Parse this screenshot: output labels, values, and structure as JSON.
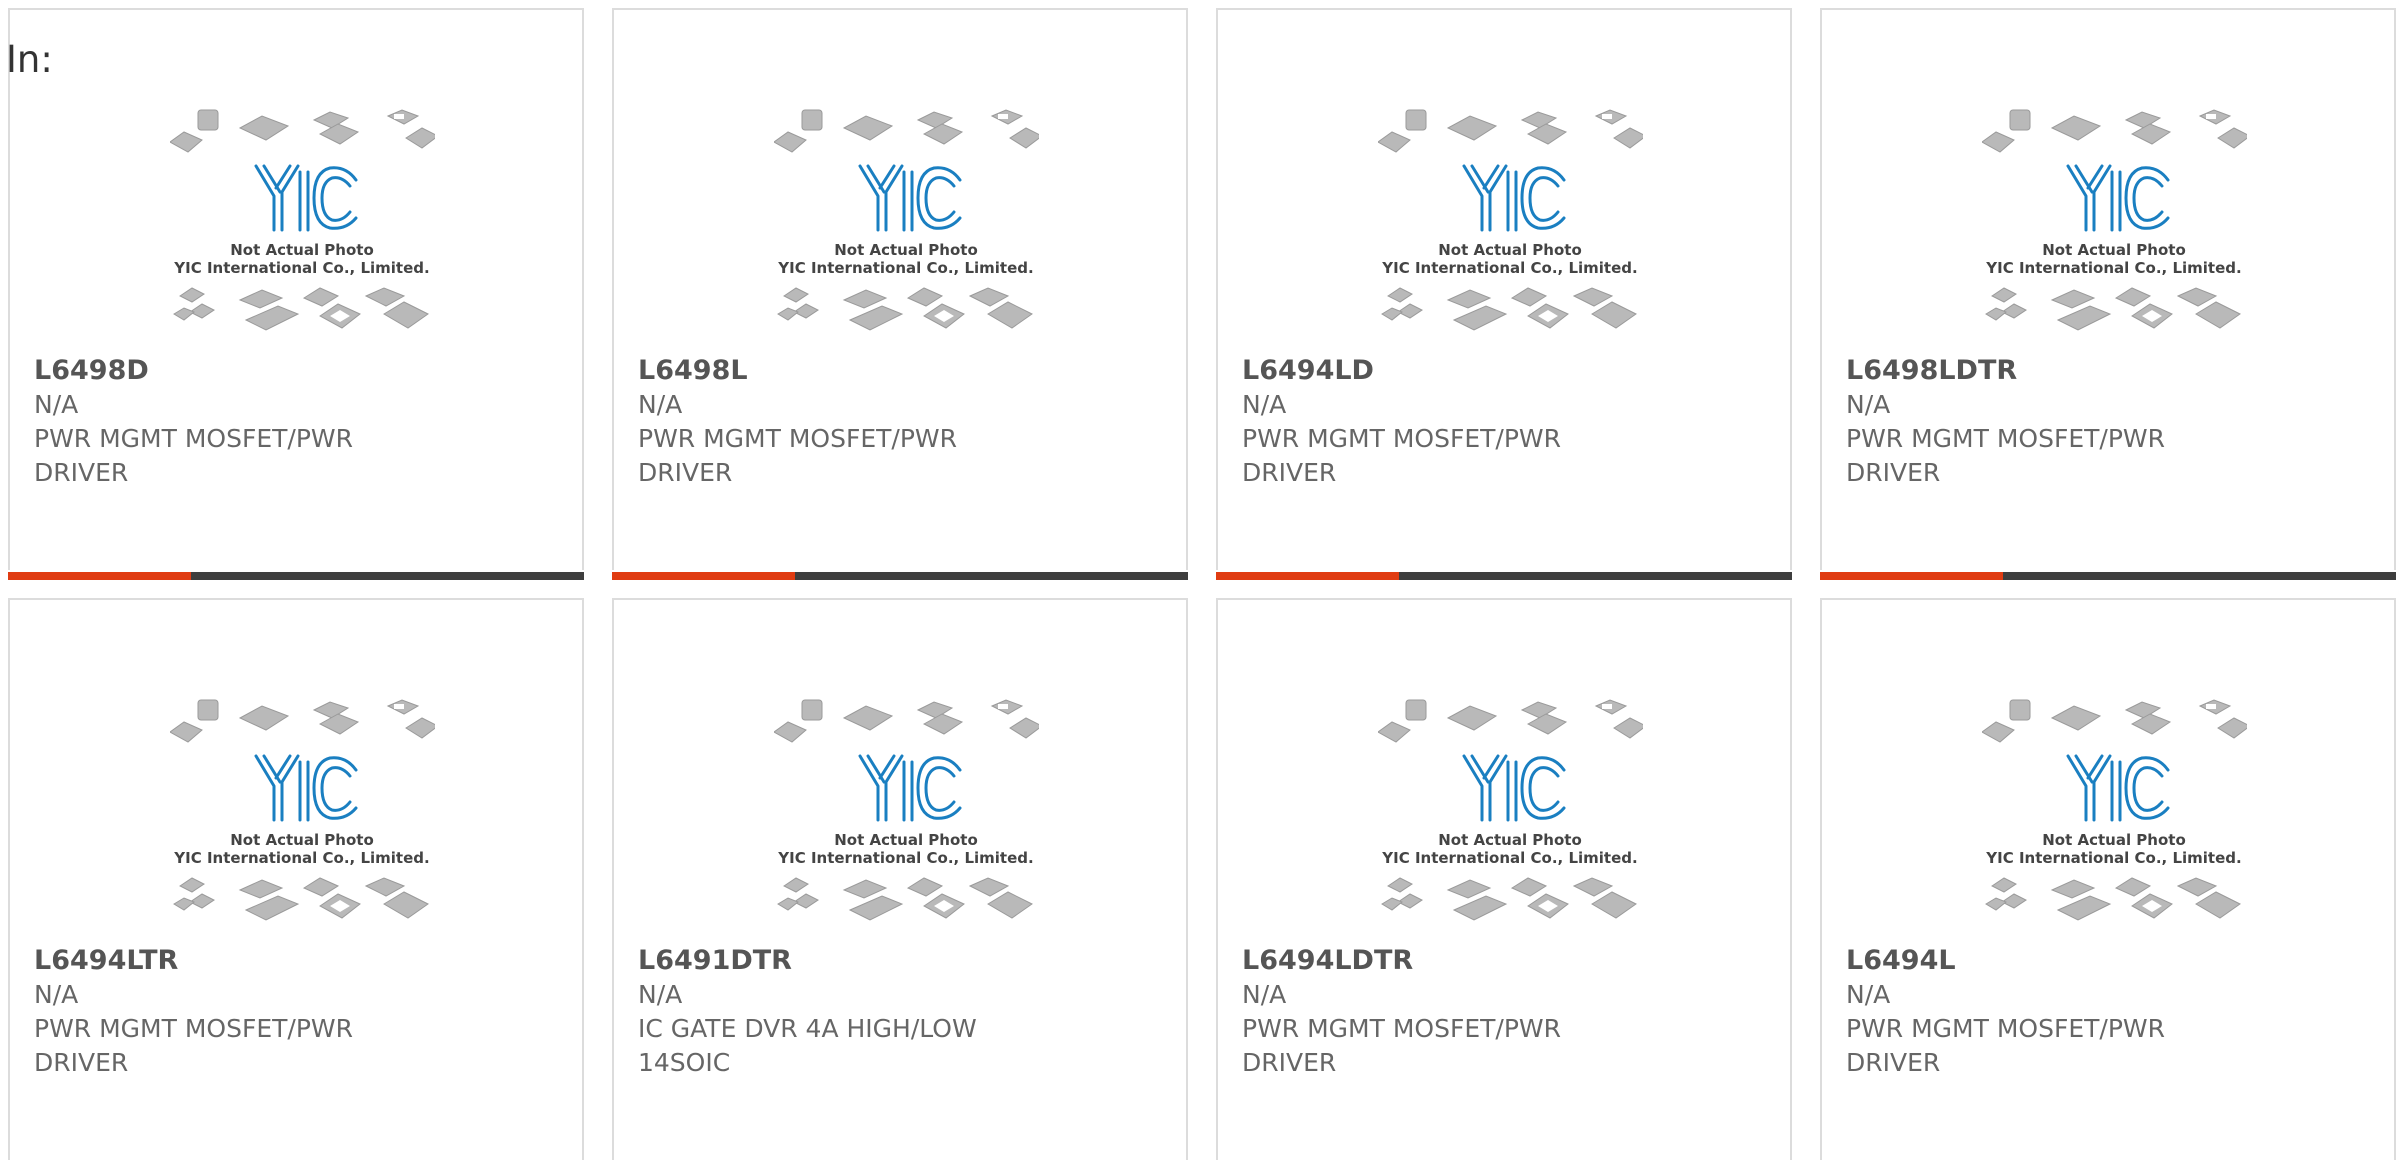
{
  "header": {
    "in_label": "In:"
  },
  "placeholder": {
    "line1": "Not Actual Photo",
    "line2": "YIC International Co., Limited.",
    "logo": "YIC"
  },
  "colors": {
    "accent": "#e03c12",
    "bar": "#3e3e3e",
    "logo_blue": "#1a7fc1",
    "chip_gray": "#b5b5b5",
    "text": "#666666"
  },
  "products": [
    {
      "part": "L6498D",
      "manufacturer": "N/A",
      "description": "PWR MGMT MOSFET/PWR DRIVER"
    },
    {
      "part": "L6498L",
      "manufacturer": "N/A",
      "description": "PWR MGMT MOSFET/PWR DRIVER"
    },
    {
      "part": "L6494LD",
      "manufacturer": "N/A",
      "description": "PWR MGMT MOSFET/PWR DRIVER"
    },
    {
      "part": "L6498LDTR",
      "manufacturer": "N/A",
      "description": "PWR MGMT MOSFET/PWR DRIVER"
    },
    {
      "part": "L6494LTR",
      "manufacturer": "N/A",
      "description": "PWR MGMT MOSFET/PWR DRIVER"
    },
    {
      "part": "L6491DTR",
      "manufacturer": "N/A",
      "description": "IC GATE DVR 4A HIGH/LOW 14SOIC"
    },
    {
      "part": "L6494LDTR",
      "manufacturer": "N/A",
      "description": "PWR MGMT MOSFET/PWR DRIVER"
    },
    {
      "part": "L6494L",
      "manufacturer": "N/A",
      "description": "PWR MGMT MOSFET/PWR DRIVER"
    }
  ]
}
